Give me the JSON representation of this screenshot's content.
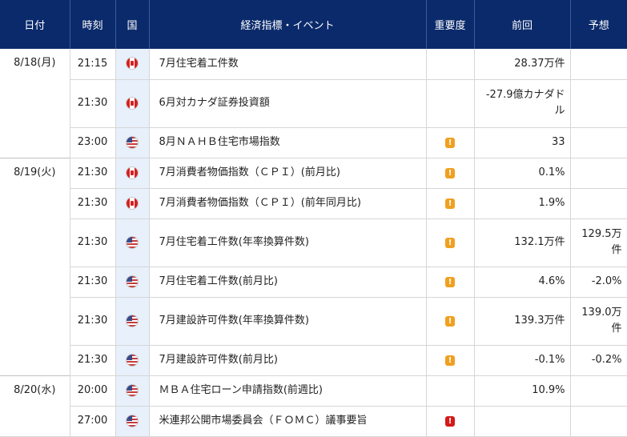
{
  "header": {
    "date": "日付",
    "time": "時刻",
    "country": "国",
    "event": "経済指標・イベント",
    "importance": "重要度",
    "previous": "前回",
    "forecast": "予想"
  },
  "rows": [
    {
      "date": "8/18(月)",
      "time": "21:15",
      "country": "canada-flag-icon",
      "event": "7月住宅着工件数",
      "importance": "",
      "previous": "28.37万件",
      "forecast": ""
    },
    {
      "date": "",
      "time": "21:30",
      "country": "canada-flag-icon",
      "event": "6月対カナダ証券投資額",
      "importance": "",
      "previous": "-27.9億カナダドル",
      "forecast": ""
    },
    {
      "date": "",
      "time": "23:00",
      "country": "us-flag-icon",
      "event": "8月ＮＡＨＢ住宅市場指数",
      "importance": "!",
      "previous": "33",
      "forecast": ""
    },
    {
      "date": "8/19(火)",
      "time": "21:30",
      "country": "canada-flag-icon",
      "event": "7月消費者物価指数（ＣＰＩ）(前月比)",
      "importance": "!",
      "previous": "0.1%",
      "forecast": ""
    },
    {
      "date": "",
      "time": "21:30",
      "country": "canada-flag-icon",
      "event": "7月消費者物価指数（ＣＰＩ）(前年同月比)",
      "importance": "!",
      "previous": "1.9%",
      "forecast": ""
    },
    {
      "date": "",
      "time": "21:30",
      "country": "us-flag-icon",
      "event": "7月住宅着工件数(年率換算件数)",
      "importance": "!",
      "previous": "132.1万件",
      "forecast": "129.5万件"
    },
    {
      "date": "",
      "time": "21:30",
      "country": "us-flag-icon",
      "event": "7月住宅着工件数(前月比)",
      "importance": "!",
      "previous": "4.6%",
      "forecast": "-2.0%"
    },
    {
      "date": "",
      "time": "21:30",
      "country": "us-flag-icon",
      "event": "7月建設許可件数(年率換算件数)",
      "importance": "!",
      "previous": "139.3万件",
      "forecast": "139.0万件"
    },
    {
      "date": "",
      "time": "21:30",
      "country": "us-flag-icon",
      "event": "7月建設許可件数(前月比)",
      "importance": "!",
      "previous": "-0.1%",
      "forecast": "-0.2%"
    },
    {
      "date": "8/20(水)",
      "time": "20:00",
      "country": "us-flag-icon",
      "event": "ＭＢＡ住宅ローン申請指数(前週比)",
      "importance": "",
      "previous": "10.9%",
      "forecast": ""
    },
    {
      "date": "",
      "time": "27:00",
      "country": "us-flag-icon",
      "event": "米連邦公開市場委員会（ＦＯＭＣ）議事要旨",
      "importance": "!",
      "previous": "",
      "forecast": ""
    }
  ],
  "colors": {
    "header_bg": "#0a2a6b",
    "country_col_bg": "#e7f0fb",
    "importance_mid": "#f0a020",
    "importance_high": "#d41a1a"
  }
}
